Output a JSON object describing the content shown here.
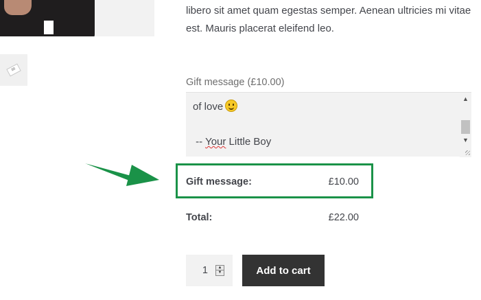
{
  "product": {
    "description": "libero sit amet quam egestas semper. Aenean ultricies mi vitae est. Mauris placerat eleifend leo."
  },
  "gift": {
    "label": "Gift message (£10.00)",
    "message_line1": "of love",
    "message_line3_prefix": " -- ",
    "message_line3_word": "Your",
    "message_line3_rest": " Little Boy"
  },
  "summary": {
    "gift_label": "Gift message:",
    "gift_value": "£10.00",
    "total_label": "Total:",
    "total_value": "£22.00"
  },
  "cart": {
    "quantity": "1",
    "add_label": "Add to cart"
  },
  "colors": {
    "highlight": "#1a9248",
    "button": "#333333"
  }
}
